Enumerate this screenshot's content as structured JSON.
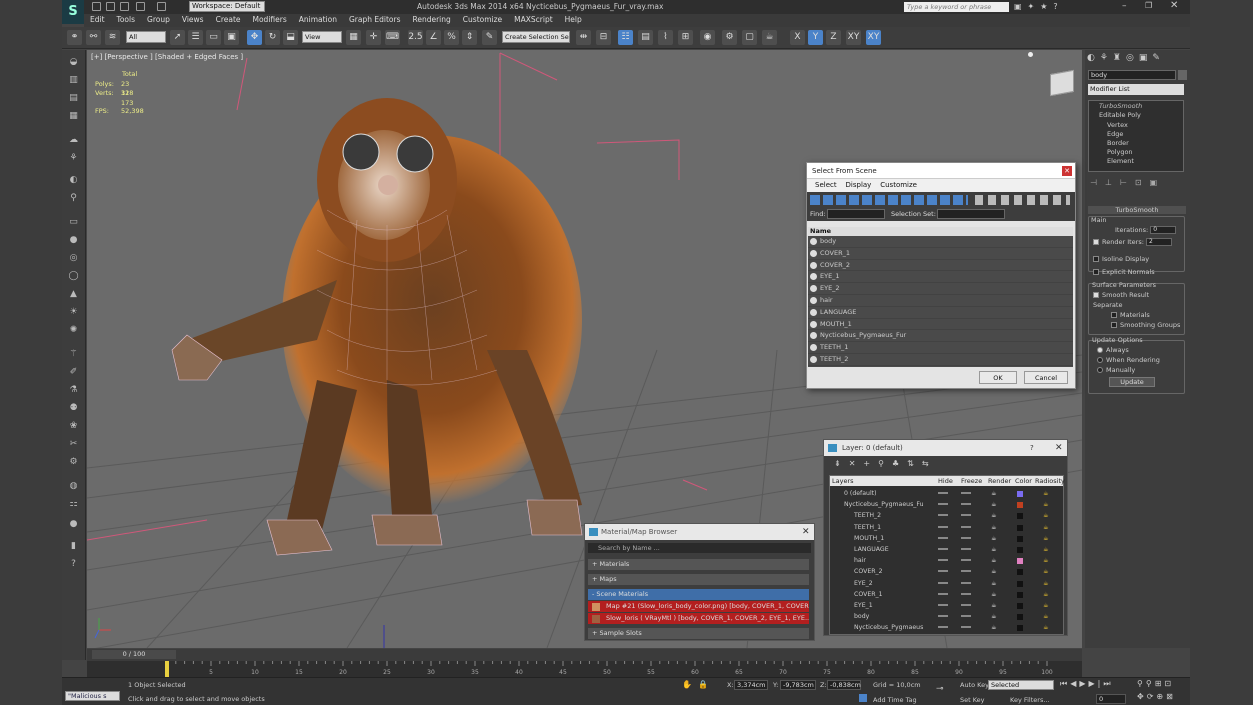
{
  "app": {
    "title": "Autodesk 3ds Max  2014 x64    Nycticebus_Pygmaeus_Fur_vray.max",
    "workspace": "Workspace: Default",
    "search_placeholder": "Type a keyword or phrase"
  },
  "menu": [
    "Edit",
    "Tools",
    "Group",
    "Views",
    "Create",
    "Modifiers",
    "Animation",
    "Graph Editors",
    "Rendering",
    "Customize",
    "MAXScript",
    "Help"
  ],
  "toolbar": {
    "filter": "All",
    "refcoord": "View",
    "selset": "Create Selection Se",
    "axes": [
      "X",
      "Y",
      "Z",
      "XY",
      "XY"
    ],
    "snap": "2.5"
  },
  "viewport": {
    "label": "[+] [Perspective ] [Shaded + Edged Faces ]",
    "stats": {
      "total_label": "Total",
      "polys_label": "Polys:",
      "polys": "23 318",
      "verts_label": "Verts:",
      "verts": "12 173",
      "fps_label": "FPS:",
      "fps": "52,398"
    },
    "axis": {
      "x": "x",
      "y": "y",
      "z": "z"
    }
  },
  "command_panel": {
    "object_name": "body",
    "modifier_list": "Modifier List",
    "stack": [
      "TurboSmooth",
      "Editable Poly",
      "Vertex",
      "Edge",
      "Border",
      "Polygon",
      "Element"
    ],
    "rollout_title": "TurboSmooth",
    "main_label": "Main",
    "iterations_label": "Iterations:",
    "iterations": "0",
    "render_iters_label": "Render Iters:",
    "render_iters": "2",
    "isoline": "Isoline Display",
    "explicit": "Explicit Normals",
    "surface_label": "Surface Parameters",
    "smooth_result": "Smooth Result",
    "separate": "Separate",
    "materials": "Materials",
    "smoothing_groups": "Smoothing Groups",
    "update_options": "Update Options",
    "always": "Always",
    "when_rendering": "When Rendering",
    "manually": "Manually",
    "update_btn": "Update"
  },
  "select_from_scene": {
    "title": "Select From Scene",
    "menus": [
      "Select",
      "Display",
      "Customize"
    ],
    "find_label": "Find:",
    "selset_label": "Selection Set:",
    "column": "Name",
    "items": [
      "body",
      "COVER_1",
      "COVER_2",
      "EYE_1",
      "EYE_2",
      "hair",
      "LANGUAGE",
      "MOUTH_1",
      "Nycticebus_Pygmaeus_Fur",
      "TEETH_1",
      "TEETH_2"
    ],
    "ok": "OK",
    "cancel": "Cancel"
  },
  "layer_window": {
    "title": "Layer: 0 (default)",
    "help": "?",
    "columns": [
      "Layers",
      "Hide",
      "Freeze",
      "Render",
      "Color",
      "Radiosity"
    ],
    "rows": [
      {
        "name": "0 (default)",
        "color": "#7a6cf0"
      },
      {
        "name": "Nycticebus_Pygmaeus_Fu",
        "color": "#c04020"
      },
      {
        "name": "TEETH_2",
        "color": "#111111"
      },
      {
        "name": "TEETH_1",
        "color": "#111111"
      },
      {
        "name": "MOUTH_1",
        "color": "#111111"
      },
      {
        "name": "LANGUAGE",
        "color": "#111111"
      },
      {
        "name": "hair",
        "color": "#e080c0"
      },
      {
        "name": "COVER_2",
        "color": "#111111"
      },
      {
        "name": "EYE_2",
        "color": "#111111"
      },
      {
        "name": "COVER_1",
        "color": "#111111"
      },
      {
        "name": "EYE_1",
        "color": "#111111"
      },
      {
        "name": "body",
        "color": "#111111"
      },
      {
        "name": "Nycticebus_Pygmaeus",
        "color": "#111111"
      }
    ]
  },
  "material_browser": {
    "title": "Material/Map Browser",
    "search": "Search by Name ...",
    "sections": [
      "+ Materials",
      "+ Maps",
      "- Scene Materials",
      "+ Sample Slots"
    ],
    "entries": [
      "Map #21 (Slow_loris_body_color.png) [body, COVER_1, COVER...",
      "Slow_loris  ( VRayMtl )  [body, COVER_1, COVER_2, EYE_1, EYE..."
    ]
  },
  "timeline": {
    "frame": "0 / 100",
    "ticks": [
      "0",
      "5",
      "10",
      "15",
      "20",
      "25",
      "30",
      "35",
      "40",
      "45",
      "50",
      "55",
      "60",
      "65",
      "70",
      "75",
      "80",
      "85",
      "90",
      "95",
      "100"
    ]
  },
  "status": {
    "script": "\"Malicious s",
    "selected": "1 Object Selected",
    "prompt": "Click and drag to select and move objects",
    "x_label": "X:",
    "x": "3,374cm",
    "y_label": "Y:",
    "y": "-9,783cm",
    "z_label": "Z:",
    "z": "-0,838cm",
    "grid": "Grid = 10,0cm",
    "autokey": "Auto Key",
    "setkey": "Set Key",
    "selected_dd": "Selected",
    "key_filters": "Key Filters...",
    "add_time_tag": "Add Time Tag",
    "frame": "0"
  }
}
